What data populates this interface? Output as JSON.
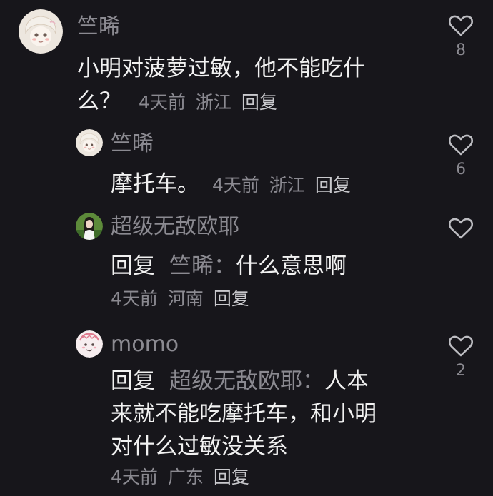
{
  "comments": [
    {
      "username": "竺晞",
      "text_line1": "小明对菠萝过敏，他不能吃什",
      "text_line2": "么？",
      "time": "4天前",
      "location": "浙江",
      "reply_label": "回复",
      "like_count": "8",
      "avatar": "cartoon-girl-avatar"
    },
    {
      "username": "竺晞",
      "text": "摩托车。",
      "time": "4天前",
      "location": "浙江",
      "reply_label": "回复",
      "like_count": "6",
      "avatar": "cartoon-girl-avatar"
    },
    {
      "username": "超级无敌欧耶",
      "reply_prefix": "回复",
      "mention": "竺晞：",
      "text": "什么意思啊",
      "time": "4天前",
      "location": "河南",
      "reply_label": "回复",
      "like_count": "",
      "avatar": "photo-girl-avatar"
    },
    {
      "username": "momo",
      "reply_prefix": "回复",
      "mention": "超级无敌欧耶：",
      "text_line1": "人本",
      "text_line2": "来就不能吃摩托车，和小明",
      "text_line3": "对什么过敏没关系",
      "time": "4天前",
      "location": "广东",
      "reply_label": "回复",
      "like_count": "2",
      "avatar": "pink-doodle-avatar"
    }
  ],
  "colors": {
    "background": "#17161b",
    "primary_text": "#f1f1f1",
    "secondary_text": "#8b8a91",
    "icon": "#bdbdc2"
  },
  "icons": {
    "like": "heart-outline-icon"
  }
}
